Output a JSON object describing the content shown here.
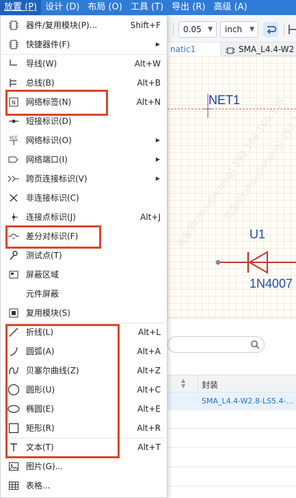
{
  "menubar": {
    "items": [
      "放置 (P)",
      "设计 (D)",
      "布局 (O)",
      "工具 (T)",
      "导出 (R)",
      "高级 (A)"
    ]
  },
  "toolbar": {
    "line_width": "0.05",
    "unit": "inch"
  },
  "tabs": {
    "schematic": "natic1",
    "footprint": "SMA_L4.4-W2"
  },
  "canvas": {
    "net_label": "NET1",
    "designator": "U1",
    "part_value": "1N4007"
  },
  "bottom_panel": {
    "column_footprint": "封装",
    "row1_footprint": "SMA_L4.4-W2.8-LS5.4-..."
  },
  "place_menu": {
    "items": [
      {
        "label": "器件/复用模块(P)...",
        "shortcut": "Shift+F",
        "icon": "component-icon",
        "submenu": false
      },
      {
        "label": "快捷器件(F)",
        "shortcut": "",
        "icon": "quick-component-icon",
        "submenu": true
      },
      {
        "label": "导线(W)",
        "shortcut": "Alt+W",
        "icon": "wire-icon",
        "submenu": false
      },
      {
        "label": "总线(B)",
        "shortcut": "Alt+B",
        "icon": "bus-icon",
        "submenu": false
      },
      {
        "label": "网络标签(N)",
        "shortcut": "Alt+N",
        "icon": "net-label-icon",
        "submenu": false
      },
      {
        "label": "短接标识(D)",
        "shortcut": "",
        "icon": "short-flag-icon",
        "submenu": false
      },
      {
        "label": "网络标识(O)",
        "shortcut": "",
        "icon": "net-flag-icon",
        "submenu": true
      },
      {
        "label": "网络端口(I)",
        "shortcut": "",
        "icon": "net-port-icon",
        "submenu": true
      },
      {
        "label": "跨页连接标识(V)",
        "shortcut": "",
        "icon": "off-page-connector-icon",
        "submenu": true
      },
      {
        "label": "非连接标识(C)",
        "shortcut": "",
        "icon": "no-connect-icon",
        "submenu": false
      },
      {
        "label": "连接点标识(J)",
        "shortcut": "Alt+J",
        "icon": "junction-icon",
        "submenu": false
      },
      {
        "label": "差分对标识(F)",
        "shortcut": "",
        "icon": "diff-pair-icon",
        "submenu": false
      },
      {
        "label": "测试点(T)",
        "shortcut": "",
        "icon": "test-point-icon",
        "submenu": false
      },
      {
        "label": "屏蔽区域",
        "shortcut": "",
        "icon": "shield-area-icon",
        "submenu": false
      },
      {
        "label": "元件屏蔽",
        "shortcut": "",
        "icon": "",
        "submenu": false
      },
      {
        "label": "复用模块(S)",
        "shortcut": "",
        "icon": "reuse-module-icon",
        "submenu": false
      },
      {
        "label": "折线(L)",
        "shortcut": "Alt+L",
        "icon": "polyline-icon",
        "submenu": false
      },
      {
        "label": "圆弧(A)",
        "shortcut": "Alt+A",
        "icon": "arc-icon",
        "submenu": false
      },
      {
        "label": "贝塞尔曲线(Z)",
        "shortcut": "Alt+Z",
        "icon": "bezier-icon",
        "submenu": false
      },
      {
        "label": "圆形(U)",
        "shortcut": "Alt+C",
        "icon": "circle-icon",
        "submenu": false
      },
      {
        "label": "椭圆(E)",
        "shortcut": "Alt+E",
        "icon": "ellipse-icon",
        "submenu": false
      },
      {
        "label": "矩形(R)",
        "shortcut": "Alt+R",
        "icon": "rectangle-icon",
        "submenu": false
      },
      {
        "label": "文本(T)",
        "shortcut": "Alt+T",
        "icon": "text-icon",
        "submenu": false
      },
      {
        "label": "图片(G)...",
        "shortcut": "",
        "icon": "image-icon",
        "submenu": false
      },
      {
        "label": "表格...",
        "shortcut": "",
        "icon": "table-icon",
        "submenu": false
      }
    ],
    "submenu_arrow": "▶"
  },
  "watermark": "周金明(zhoujinming) 192.168.160.139",
  "colors": {
    "menubar": "#2f7bd8",
    "highlight": "#d9452b",
    "wire": "#c0392b",
    "designator_text": "#1e4fa8",
    "net_label_text": "#1e3f9e",
    "footprint_link": "#1a73c8"
  }
}
